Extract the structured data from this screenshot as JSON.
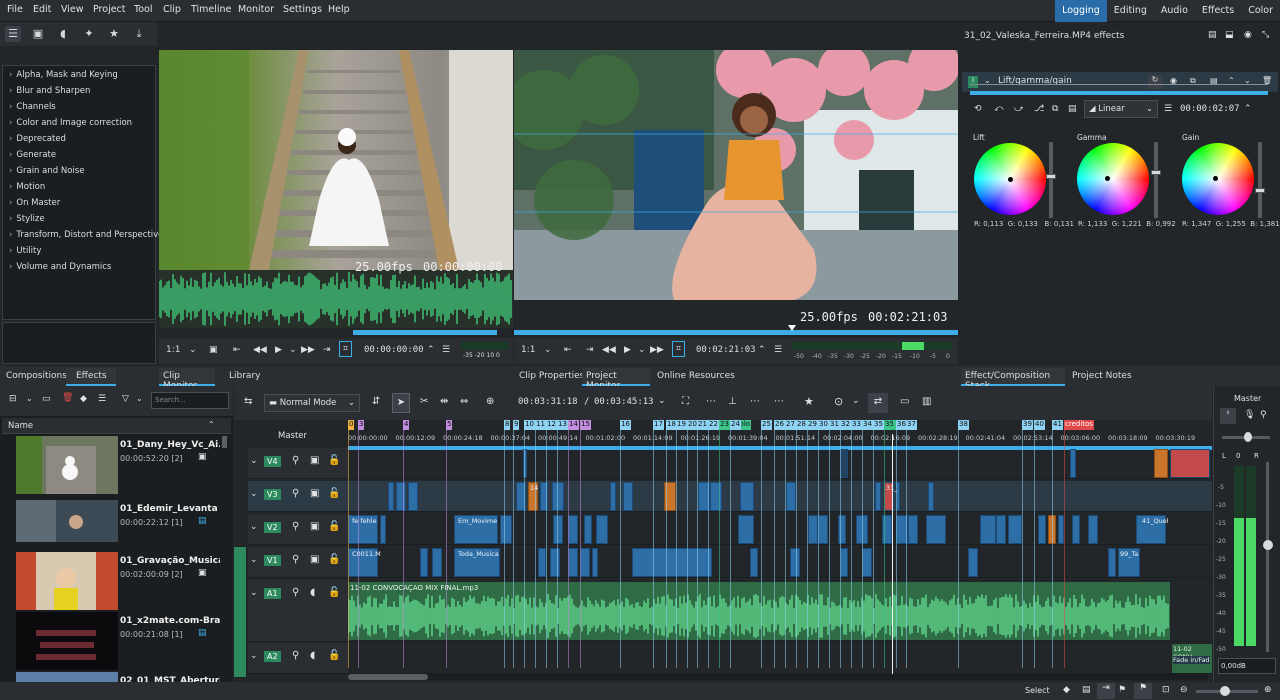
{
  "menu": [
    "File",
    "Edit",
    "View",
    "Project",
    "Tool",
    "Clip",
    "Timeline",
    "Monitor",
    "Settings",
    "Help"
  ],
  "layouts": [
    "Logging",
    "Editing",
    "Audio",
    "Effects",
    "Color"
  ],
  "active_layout": "Effects",
  "effect_categories": [
    "Alpha, Mask and Keying",
    "Blur and Sharpen",
    "Channels",
    "Color and Image correction",
    "Deprecated",
    "Generate",
    "Grain and Noise",
    "Motion",
    "On Master",
    "Stylize",
    "Transform, Distort and Perspective",
    "Utility",
    "Volume and Dynamics"
  ],
  "clip_monitor": {
    "fps": "25.00fps",
    "timecode": "00:00:00:00",
    "zoom": "1:1",
    "position": "00:00:00:00",
    "meter_ticks": "-35 -20 10 0"
  },
  "project_monitor": {
    "fps": "25.00fps",
    "timecode": "00:02:21:03",
    "zoom": "1:1",
    "position": "00:02:21:03",
    "meter_ticks": [
      "-50",
      "-40",
      "-35",
      "-30",
      "-25",
      "-20",
      "-15",
      "-10",
      "-5",
      "0"
    ]
  },
  "effect_stack": {
    "title": "31_02_Valeska_Ferreira.MP4 effects",
    "effect_name": "Lift/gamma/gain",
    "interpolation": "Linear",
    "timecode": "00:00:02:07",
    "wheels": [
      {
        "label": "Lift",
        "r": "R: 0,113",
        "g": "G: 0,133",
        "b": "B: 0,131"
      },
      {
        "label": "Gamma",
        "r": "R: 1,133",
        "g": "G: 1,221",
        "b": "B: 0,992"
      },
      {
        "label": "Gain",
        "r": "R: 1,347",
        "g": "G: 1,255",
        "b": "B: 1,381"
      }
    ]
  },
  "tabs_row": {
    "left": [
      "Compositions",
      "Effects"
    ],
    "monitor": [
      "Clip Monitor",
      "Library"
    ],
    "center": [
      "Clip Properties",
      "Project Monitor",
      "Online Resources"
    ],
    "right": [
      "Effect/Composition Stack",
      "Project Notes"
    ]
  },
  "bin": {
    "search_placeholder": "Search...",
    "column": "Name",
    "items": [
      {
        "name": "01_Dany_Hey_Vc_Ai.MP4",
        "duration": "00:00:52:20 [2]"
      },
      {
        "name": "01_Edemir_Levanta da",
        "duration": "00:00:22:12 [1]"
      },
      {
        "name": "01_Gravação_Musica_C",
        "duration": "00:02:00:09 [2]"
      },
      {
        "name": "01_x2mate.com-Brasil c",
        "duration": "00:00:21:08 [1]"
      },
      {
        "name": "02_01_MST_Abertura_N",
        "duration": ""
      }
    ]
  },
  "timeline": {
    "mode": "Normal Mode",
    "position": "00:03:31:18",
    "duration": "00:03:45:13",
    "master_label": "Master",
    "ruler": [
      "00:00:00:00",
      "00:00:12:09",
      "00:00:24:18",
      "00:00:37:04",
      "00:00:49:14",
      "00:01:02:00",
      "00:01:14:09",
      "00:01:26:19",
      "00:01:39:04",
      "00:01:51:14",
      "00:02:04:00",
      "00:02:16:09",
      "00:02:28:19",
      "00:02:41:04",
      "00:02:53:14",
      "00:03:06:00",
      "00:03:18:09",
      "00:03:30:19"
    ],
    "tracks": [
      "V4",
      "V3",
      "V2",
      "V1",
      "A1",
      "A2"
    ],
    "audio_clip": "11-02 CONVOCAÇAO MIX FINAL.mp3",
    "a2_clip": "11-02 CONV",
    "a2_clip_effect": "Fade in/Fad",
    "markers": [
      "0",
      "3",
      "4",
      "5",
      "8",
      "9",
      "10",
      "11",
      "12",
      "13",
      "14",
      "15",
      "16",
      "17",
      "18",
      "19",
      "20",
      "21",
      "22",
      "23 - solo",
      "24",
      "25",
      "26",
      "27",
      "28",
      "29",
      "30",
      "31",
      "32",
      "33",
      "34",
      "35",
      "35 - solo",
      "36",
      "37",
      "38",
      "39",
      "40",
      "41",
      "creditos"
    ]
  },
  "mixer": {
    "title": "Master",
    "level": "0,00dB",
    "scale": [
      "-5",
      "-10",
      "-15",
      "-20",
      "-25",
      "-30",
      "-35",
      "-40",
      "-45",
      "-50"
    ]
  },
  "status": {
    "tool": "Select"
  }
}
